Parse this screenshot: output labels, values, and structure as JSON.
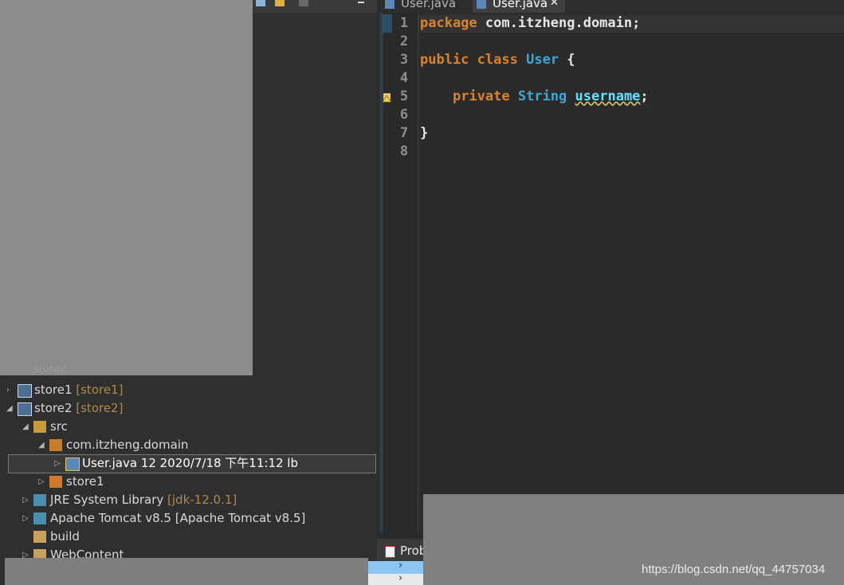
{
  "editor": {
    "tabs": [
      {
        "label": "User.java",
        "active": false
      },
      {
        "label": "User.java",
        "active": true,
        "close": "✕"
      }
    ],
    "line_numbers": [
      "1",
      "2",
      "3",
      "4",
      "5",
      "6",
      "7",
      "8"
    ],
    "code": {
      "l1_kw": "package",
      "l1_rest": " com.itzheng.domain;",
      "l3_kw1": "public",
      "l3_kw2": "class",
      "l3_type": "User",
      "l3_rest": " {",
      "l5_indent": "    ",
      "l5_kw": "private",
      "l5_type": "String",
      "l5_field": "username",
      "l5_rest": ";",
      "l7": "}"
    }
  },
  "project_explorer": {
    "cut_top_label": "store2",
    "items": [
      {
        "label": "store1",
        "decoration": "[store1]"
      },
      {
        "label": "store2",
        "decoration": "[store2]"
      },
      {
        "label": "src"
      },
      {
        "label": "com.itzheng.domain"
      },
      {
        "label": "User.java 12  2020/7/18 下午11:12  lb"
      },
      {
        "label": "store1"
      },
      {
        "label": "JRE System Library",
        "decoration": "[jdk-12.0.1]"
      },
      {
        "label": "Apache Tomcat v8.5 [Apache Tomcat v8.5]"
      },
      {
        "label": "build"
      },
      {
        "label": "WebContent"
      }
    ]
  },
  "bottom_panel": {
    "tab_label": "Prob",
    "arrow1": "›",
    "arrow2": "›"
  },
  "watermark": "https://blog.csdn.net/qq_44757034",
  "colors": {
    "keyword": "#d9832b",
    "type": "#3aa8db",
    "field": "#66e0ff"
  }
}
